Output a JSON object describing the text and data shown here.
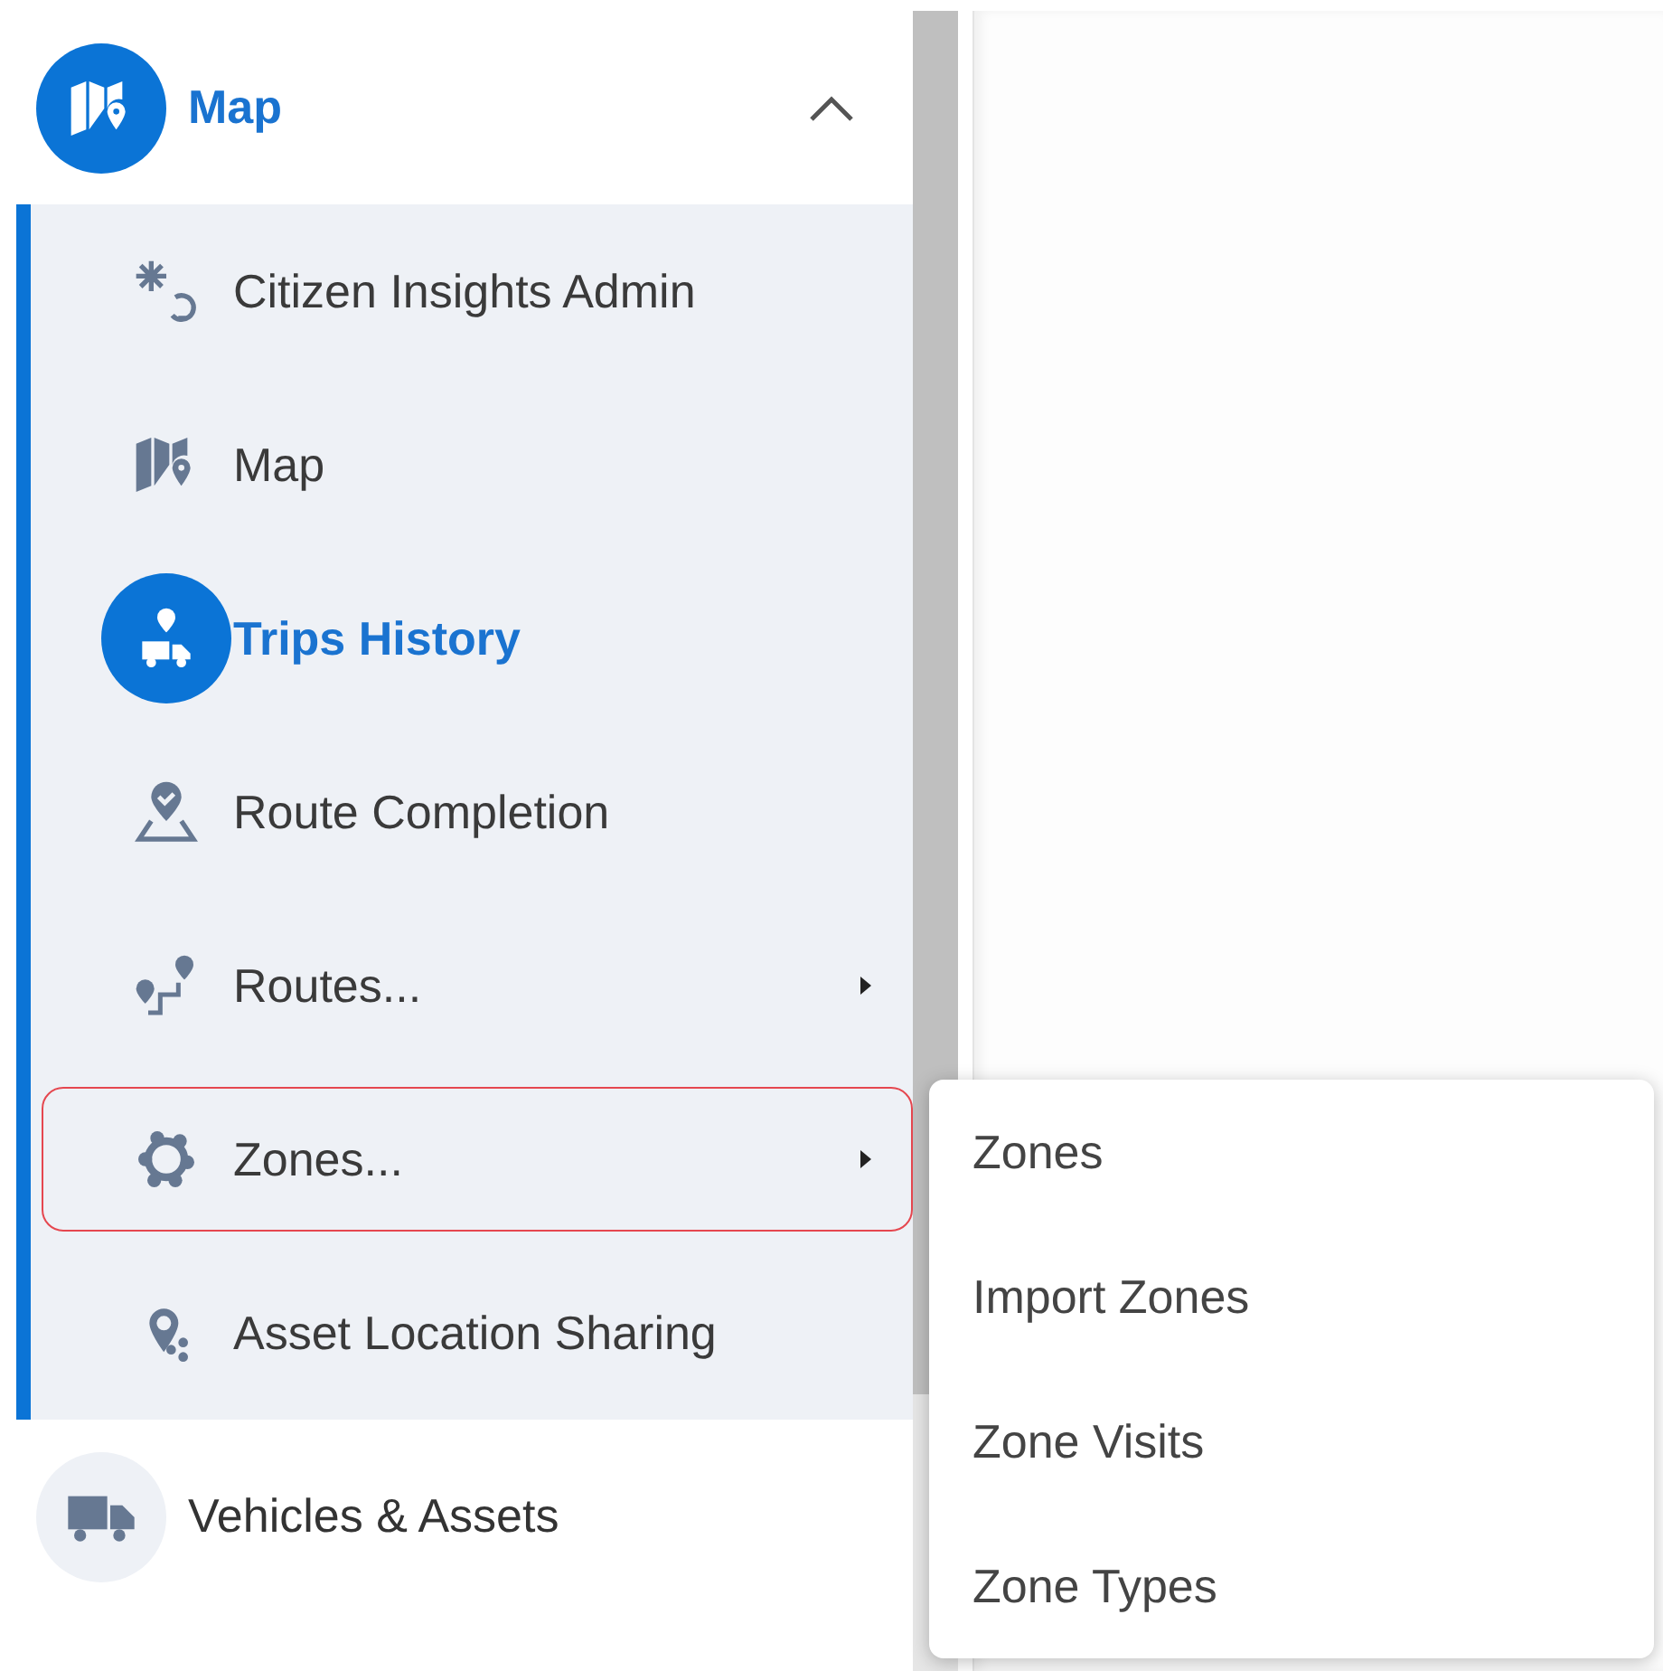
{
  "sections": [
    {
      "label": "Map",
      "selected": true,
      "expanded": true,
      "items": [
        {
          "label": "Citizen Insights Admin",
          "selected": false,
          "outlined": false,
          "submenu": false
        },
        {
          "label": "Map",
          "selected": false,
          "outlined": false,
          "submenu": false
        },
        {
          "label": "Trips History",
          "selected": true,
          "outlined": false,
          "submenu": false
        },
        {
          "label": "Route Completion",
          "selected": false,
          "outlined": false,
          "submenu": false
        },
        {
          "label": "Routes...",
          "selected": false,
          "outlined": false,
          "submenu": true
        },
        {
          "label": "Zones...",
          "selected": false,
          "outlined": true,
          "submenu": true
        },
        {
          "label": "Asset Location Sharing",
          "selected": false,
          "outlined": false,
          "submenu": false
        }
      ]
    },
    {
      "label": "Vehicles & Assets",
      "selected": false
    }
  ],
  "popup_menu": [
    "Zones",
    "Import Zones",
    "Zone Visits",
    "Zone Types"
  ]
}
